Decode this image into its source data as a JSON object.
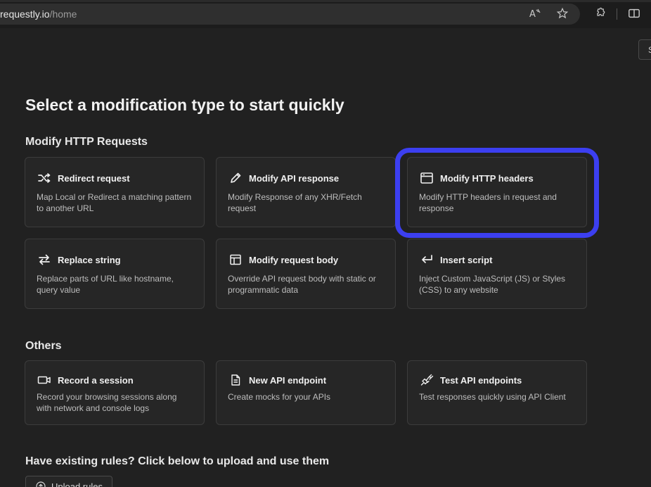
{
  "browser": {
    "url_host": "requestly.io",
    "url_path": "/home",
    "icons": [
      "read-aloud-icon",
      "favorite-star-icon",
      "extensions-icon",
      "split-screen-icon"
    ]
  },
  "top_stub_label": "S",
  "page_title": "Select a modification type to start quickly",
  "sections": {
    "http": {
      "title": "Modify HTTP Requests",
      "cards": [
        {
          "icon": "shuffle-icon",
          "title": "Redirect request",
          "desc": "Map Local or Redirect a matching pattern to another URL"
        },
        {
          "icon": "pencil-icon",
          "title": "Modify API response",
          "desc": "Modify Response of any XHR/Fetch request"
        },
        {
          "icon": "browser-window-icon",
          "title": "Modify HTTP headers",
          "desc": "Modify HTTP headers in request and response"
        },
        {
          "icon": "swap-arrows-icon",
          "title": "Replace string",
          "desc": "Replace parts of URL like hostname, query value"
        },
        {
          "icon": "layout-icon",
          "title": "Modify request body",
          "desc": "Override API request body with static or programmatic data"
        },
        {
          "icon": "enter-arrow-icon",
          "title": "Insert script",
          "desc": "Inject Custom JavaScript (JS) or Styles (CSS) to any website"
        }
      ]
    },
    "others": {
      "title": "Others",
      "cards": [
        {
          "icon": "video-camera-icon",
          "title": "Record a session",
          "desc": "Record your browsing sessions along with network and console logs"
        },
        {
          "icon": "document-icon",
          "title": "New API endpoint",
          "desc": "Create mocks for your APIs"
        },
        {
          "icon": "plug-icon",
          "title": "Test API endpoints",
          "desc": "Test responses quickly using API Client"
        }
      ]
    },
    "upload": {
      "title": "Have existing rules? Click below to upload and use them",
      "button_label": "Upload rules"
    }
  },
  "colors": {
    "background": "#212121",
    "card_background": "#262626",
    "highlight_ring": "#3c3ff0"
  }
}
